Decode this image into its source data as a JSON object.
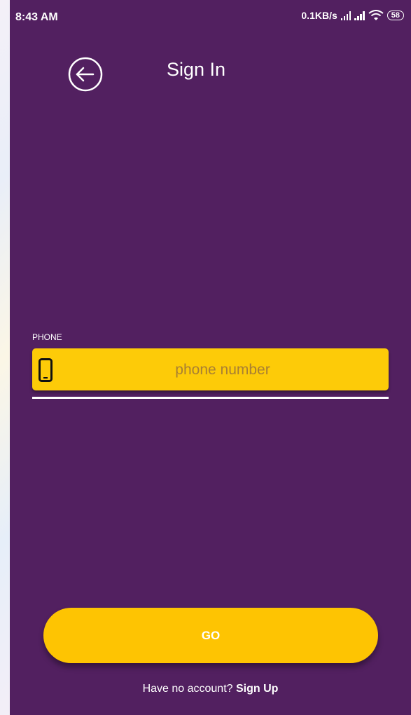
{
  "status_bar": {
    "time": "8:43 AM",
    "network_speed": "0.1KB/s",
    "battery_level": "58"
  },
  "header": {
    "title": "Sign In",
    "back_icon": "arrow-left-circle-icon"
  },
  "form": {
    "phone_label": "PHONE",
    "phone_placeholder": "phone number",
    "phone_value": "",
    "phone_icon": "smartphone-icon"
  },
  "actions": {
    "go_label": "GO"
  },
  "footer": {
    "prompt": "Have no account? ",
    "signup_label": "Sign Up"
  },
  "colors": {
    "background": "#522060",
    "field_yellow": "#fdcb08",
    "button_yellow": "#fec402",
    "text_white": "#ffffff"
  }
}
